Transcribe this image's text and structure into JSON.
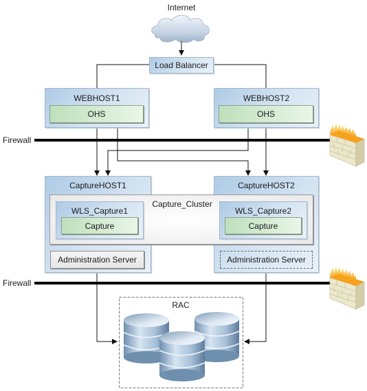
{
  "diagram": {
    "internet": {
      "label": "Internet",
      "icon": "cloud-icon"
    },
    "load_balancer": {
      "label": "Load Balancer"
    },
    "web_tier": [
      {
        "host": "WEBHOST1",
        "component": "OHS"
      },
      {
        "host": "WEBHOST2",
        "component": "OHS"
      }
    ],
    "firewalls": [
      {
        "label": "Firewall",
        "icon": "firewall-icon"
      },
      {
        "label": "Firewall",
        "icon": "firewall-icon"
      }
    ],
    "app_tier": {
      "cluster_label": "Capture_Cluster",
      "hosts": [
        {
          "host": "CaptureHOST1",
          "managed_server": "WLS_Capture1",
          "application": "Capture",
          "admin_server": "Administration Server",
          "admin_active": true
        },
        {
          "host": "CaptureHOST2",
          "managed_server": "WLS_Capture2",
          "application": "Capture",
          "admin_server": "Administration Server",
          "admin_active": false
        }
      ]
    },
    "database": {
      "label": "RAC",
      "icon": "database-icon",
      "node_count": 3
    }
  },
  "colors": {
    "host_fill": "#c6daee",
    "component_fill": "#cfe8cd",
    "admin_fill": "#ececec",
    "firewall_line": "#000000",
    "connector": "#333333",
    "database": "#7c9bb8",
    "flame": "#f6a21c",
    "brick": "#efecd2"
  }
}
